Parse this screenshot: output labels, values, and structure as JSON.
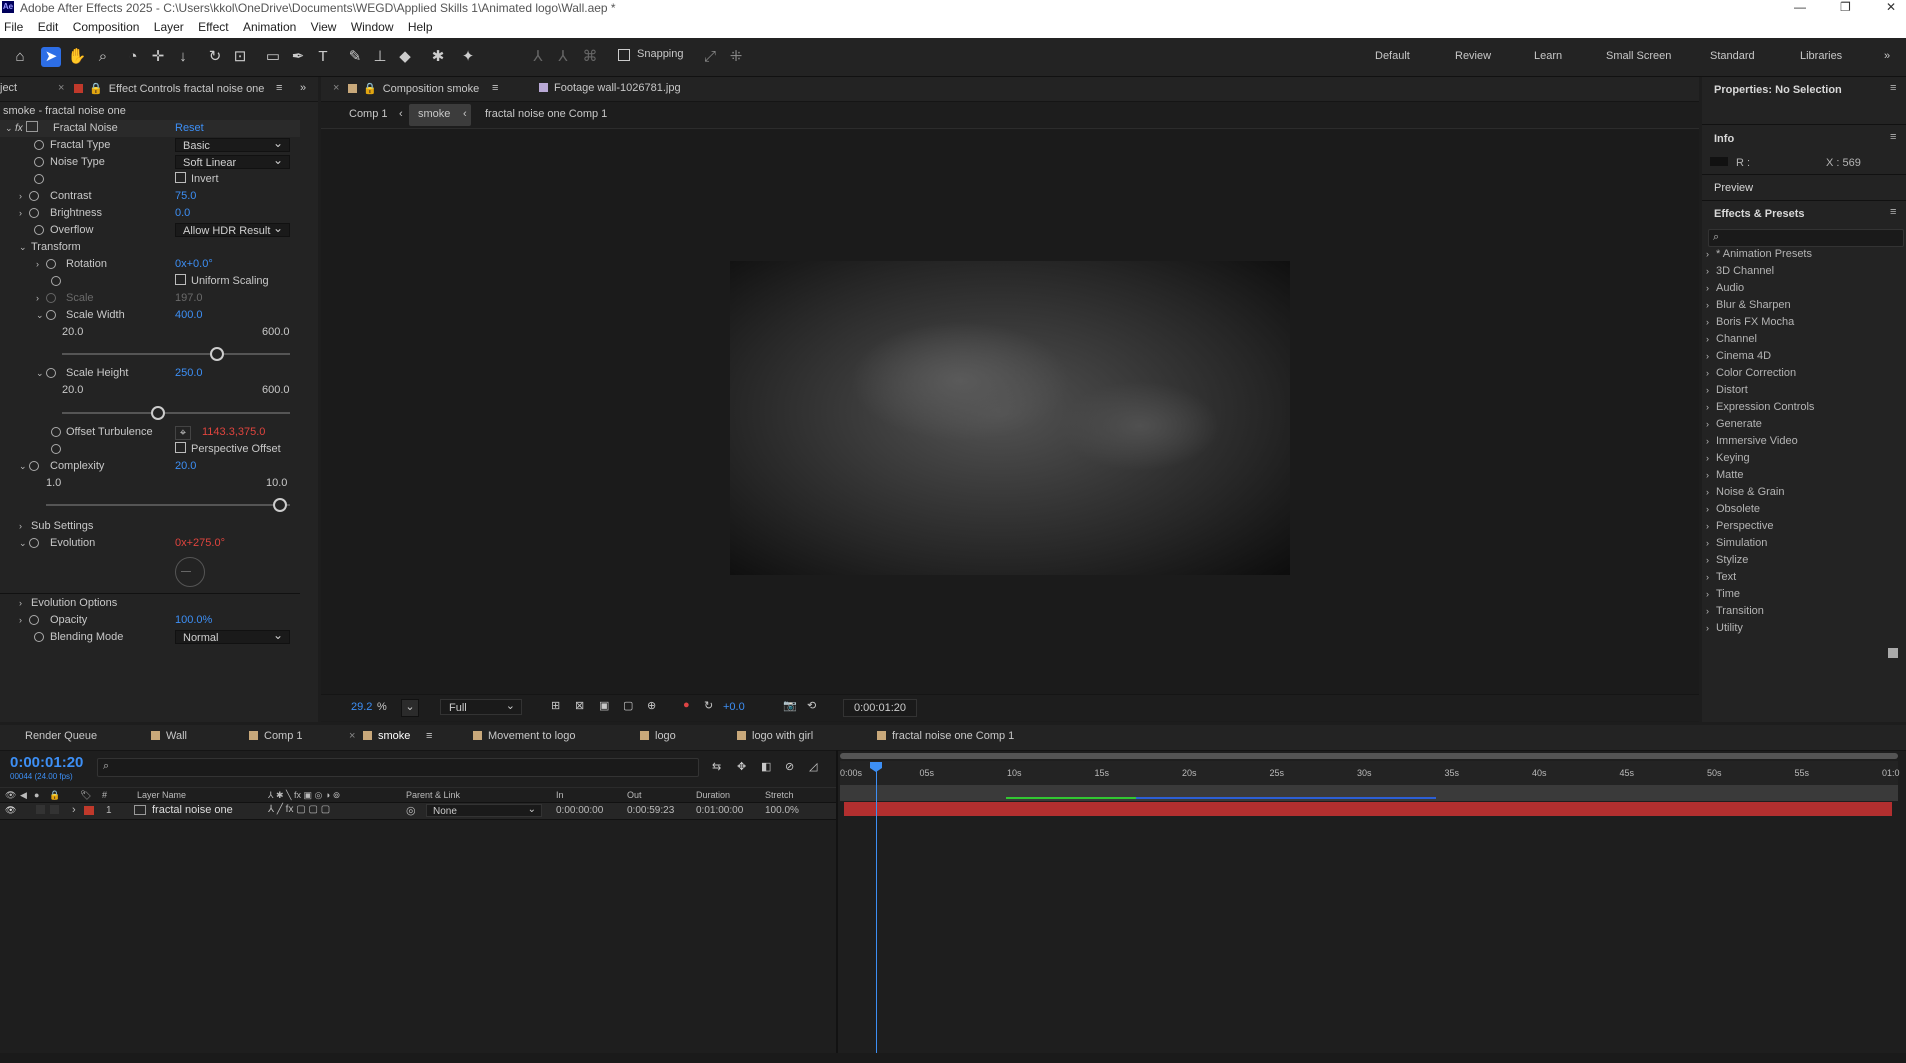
{
  "window": {
    "title": "Adobe After Effects 2025 - C:\\Users\\kkol\\OneDrive\\Documents\\WEGD\\Applied Skills 1\\Animated logo\\Wall.aep *",
    "app_badge": "Ae"
  },
  "menu": [
    "File",
    "Edit",
    "Composition",
    "Layer",
    "Effect",
    "Animation",
    "View",
    "Window",
    "Help"
  ],
  "toolbar": {
    "snapping": "Snapping",
    "workspaces": [
      "Default",
      "Review",
      "Learn",
      "Small Screen",
      "Standard",
      "Libraries"
    ]
  },
  "left_panel": {
    "tab_project": "ject",
    "tab_effect_controls": "Effect Controls fractal noise one",
    "header": "smoke - fractal noise one",
    "effect_name": "Fractal Noise",
    "reset": "Reset",
    "fractal_type": {
      "label": "Fractal Type",
      "value": "Basic"
    },
    "noise_type": {
      "label": "Noise Type",
      "value": "Soft Linear"
    },
    "invert": "Invert",
    "contrast": {
      "label": "Contrast",
      "value": "75.0"
    },
    "brightness": {
      "label": "Brightness",
      "value": "0.0"
    },
    "overflow": {
      "label": "Overflow",
      "value": "Allow HDR Result"
    },
    "transform": "Transform",
    "rotation": {
      "label": "Rotation",
      "value": "0x+0.0°"
    },
    "uniform_scaling": "Uniform Scaling",
    "scale": {
      "label": "Scale",
      "value": "197.0"
    },
    "scale_width": {
      "label": "Scale Width",
      "value": "400.0",
      "min": "20.0",
      "max": "600.0"
    },
    "scale_height": {
      "label": "Scale Height",
      "value": "250.0",
      "min": "20.0",
      "max": "600.0"
    },
    "offset_turbulence": {
      "label": "Offset Turbulence",
      "value": "1143.3,375.0"
    },
    "perspective_offset": "Perspective Offset",
    "complexity": {
      "label": "Complexity",
      "value": "20.0",
      "min": "1.0",
      "max": "10.0"
    },
    "sub_settings": "Sub Settings",
    "evolution": {
      "label": "Evolution",
      "value": "0x+275.0°"
    },
    "evolution_options": "Evolution Options",
    "opacity": {
      "label": "Opacity",
      "value": "100.0%"
    },
    "blending_mode": {
      "label": "Blending Mode",
      "value": "Normal"
    }
  },
  "composition": {
    "tab_comp": "Composition smoke",
    "tab_footage": "Footage wall-1026781.jpg",
    "breadcrumbs": [
      "Comp 1",
      "smoke",
      "fractal noise one Comp 1"
    ],
    "zoom": "29.2",
    "zoom_unit": "%",
    "resolution": "Full",
    "exposure": "+0.0",
    "timecode": "0:00:01:20"
  },
  "right_panel": {
    "properties": "Properties: No Selection",
    "info": "Info",
    "info_r": "R :",
    "info_x": "X : 569",
    "preview": "Preview",
    "effects_presets": "Effects & Presets",
    "categories": [
      "* Animation Presets",
      "3D Channel",
      "Audio",
      "Blur & Sharpen",
      "Boris FX Mocha",
      "Channel",
      "Cinema 4D",
      "Color Correction",
      "Distort",
      "Expression Controls",
      "Generate",
      "Immersive Video",
      "Keying",
      "Matte",
      "Noise & Grain",
      "Obsolete",
      "Perspective",
      "Simulation",
      "Stylize",
      "Text",
      "Time",
      "Transition",
      "Utility"
    ]
  },
  "timeline": {
    "tabs": [
      "Render Queue",
      "Wall",
      "Comp 1",
      "smoke",
      "Movement to logo",
      "logo",
      "logo with girl",
      "fractal noise one Comp 1"
    ],
    "timecode": "0:00:01:20",
    "frames": "00044 (24.00 fps)",
    "columns": {
      "layer_name": "Layer Name",
      "parent": "Parent & Link",
      "in": "In",
      "out": "Out",
      "duration": "Duration",
      "stretch": "Stretch",
      "num": "#"
    },
    "layer": {
      "index": "1",
      "name": "fractal noise one",
      "parent": "None",
      "in": "0:00:00:00",
      "out": "0:00:59:23",
      "duration": "0:01:00:00",
      "stretch": "100.0%"
    },
    "ruler": [
      "0:00s",
      "05s",
      "10s",
      "15s",
      "20s",
      "25s",
      "30s",
      "35s",
      "40s",
      "45s",
      "50s",
      "55s",
      "01:0"
    ],
    "playhead_fraction": 0.03
  },
  "colors": {
    "accent_blue": "#3d8ff5",
    "layer_red": "#b22f2f",
    "value_red": "#e0443e"
  }
}
